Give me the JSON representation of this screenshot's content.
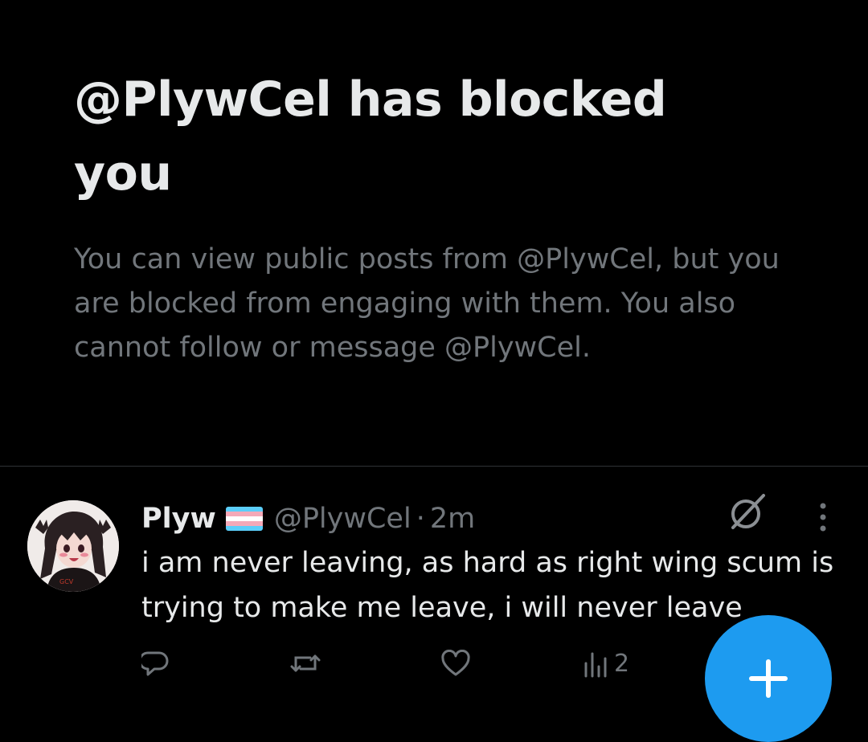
{
  "blocked": {
    "title": "@PlywCel has blocked you",
    "description": "You can view public posts from @PlywCel, but you are blocked from engaging with them. You also cannot follow or message @PlywCel."
  },
  "post": {
    "display_name": "Plyw",
    "flag_icon": "transgender-flag-emoji",
    "handle": "@PlywCel",
    "separator": "·",
    "time": "2m",
    "text": "i am never leaving, as hard as right wing scum is trying to make me leave, i will never leave",
    "views": "2"
  },
  "icons": {
    "grok": "grok-icon",
    "more": "more-vertical-icon",
    "reply": "reply-icon",
    "repost": "repost-icon",
    "like": "like-icon",
    "views": "views-icon",
    "compose": "plus-icon"
  },
  "colors": {
    "background": "#000000",
    "primary_text": "#e7e9ea",
    "secondary_text": "#71767b",
    "divider": "#2f3336",
    "accent": "#1d9bf0"
  }
}
